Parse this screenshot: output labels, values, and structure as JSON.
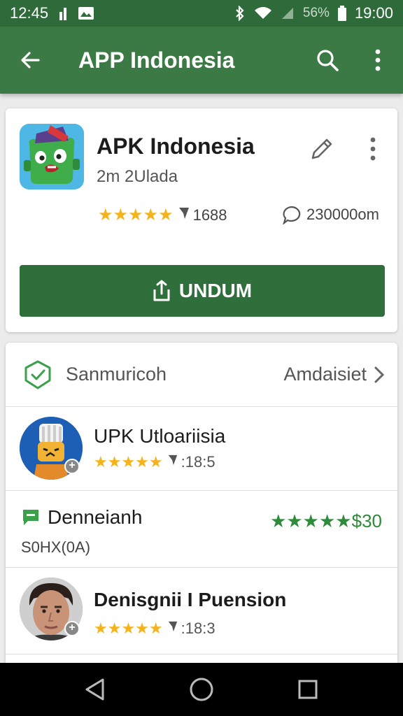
{
  "status_bar": {
    "time_left": "12:45",
    "battery_percent": "56%",
    "time_right": "19:00"
  },
  "app_bar": {
    "title": "APP Indonesia",
    "icons": [
      "back-arrow-icon",
      "search-icon",
      "more-vert-icon"
    ]
  },
  "app_card": {
    "name": "APK Indonesia",
    "subtitle": "2m 2Ulada",
    "stars": "★★★★★",
    "rating_count": "1688",
    "comments_count": "230000om",
    "install_label": "UNDUM"
  },
  "section": {
    "title": "Sanmuricoh",
    "link": "Amdaisiet"
  },
  "list": [
    {
      "title": "UPK Utloariisia",
      "stars": "★★★★★",
      "rating": ":18:5"
    },
    {
      "title": "Denneianh",
      "subtitle": "S0HX(0A)",
      "stars": "★★★★★",
      "price": "$30"
    },
    {
      "title": "Denisgnii I Puension",
      "stars": "★★★★★",
      "rating": ":18:3"
    }
  ],
  "colors": {
    "status_bar": "#2f6b3a",
    "app_bar": "#3c7a45",
    "install_button": "#2f6f3b",
    "star": "#f5b21a",
    "price_green": "#2e8b3a"
  }
}
